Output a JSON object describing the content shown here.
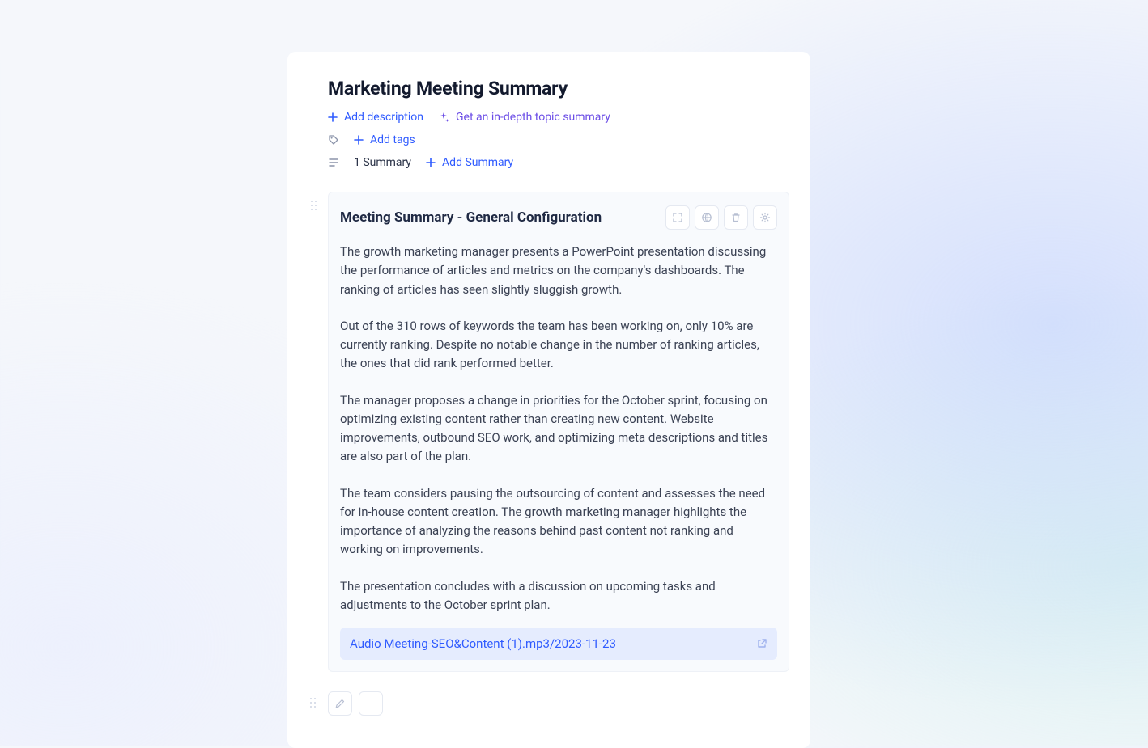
{
  "header": {
    "title": "Marketing Meeting Summary",
    "add_description": "Add description",
    "topic_summary": "Get an in-depth topic summary",
    "add_tags": "Add tags",
    "summary_count": "1 Summary",
    "add_summary": "Add Summary"
  },
  "summary": {
    "title": "Meeting Summary - General Configuration",
    "paragraphs": [
      "The growth marketing manager presents a PowerPoint presentation discussing the performance of articles and metrics on the company's dashboards. The ranking of articles has seen slightly sluggish growth.",
      "Out of the 310 rows of keywords the team has been working on, only 10% are currently ranking. Despite no notable change in the number of ranking articles, the ones that did rank performed better.",
      "The manager proposes a change in priorities for the October sprint, focusing on optimizing existing content rather than creating new content. Website improvements, outbound SEO work, and optimizing meta descriptions and titles are also part of the plan.",
      "The team considers pausing the outsourcing of content and assesses the need for in-house content creation. The growth marketing manager highlights the importance of analyzing the reasons behind past content not ranking and working on improvements.",
      "The presentation concludes with a discussion on upcoming tasks and adjustments to the October sprint plan."
    ],
    "attachment_label": "Audio Meeting-SEO&Content (1).mp3/2023-11-23"
  }
}
